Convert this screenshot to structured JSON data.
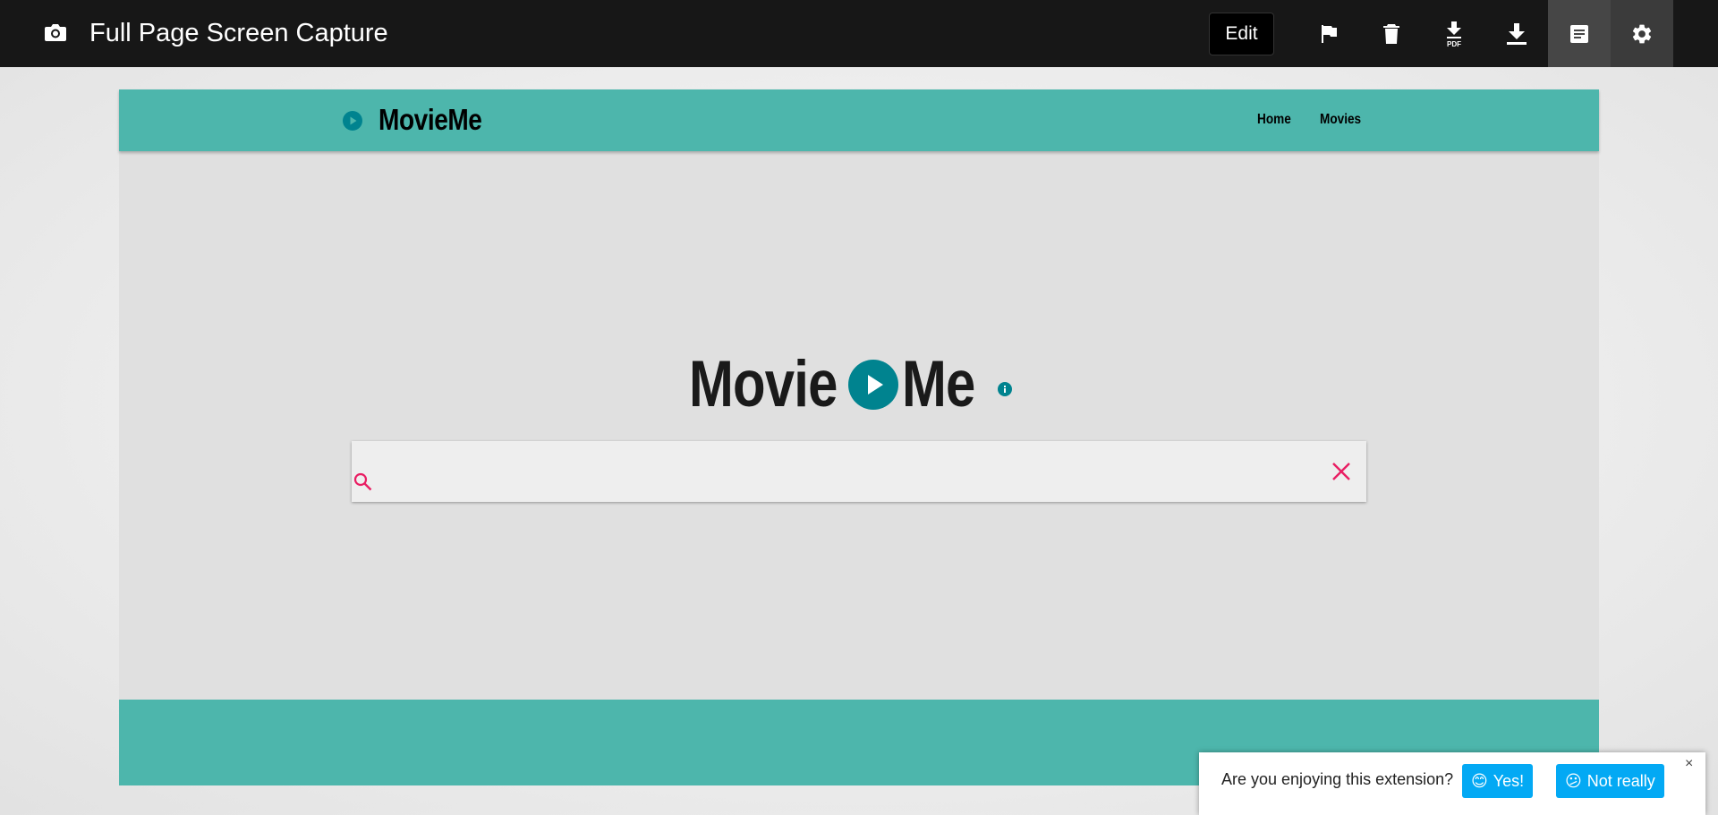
{
  "toolbar": {
    "title": "Full Page Screen Capture",
    "edit_label": "Edit",
    "icons": [
      "camera-icon",
      "flag-icon",
      "trash-icon",
      "download-pdf-icon",
      "download-icon",
      "notes-icon",
      "gear-icon"
    ],
    "pdf_badge": "PDF"
  },
  "site": {
    "brand": "MovieMe",
    "nav": {
      "home": "Home",
      "movies": "Movies"
    },
    "hero_left": "Movie",
    "hero_right": "Me",
    "search_placeholder": "",
    "search_value": ""
  },
  "feedback": {
    "question": "Are you enjoying this extension?",
    "yes_label": "Yes!",
    "yes_emoji": "😊",
    "no_label": "Not really",
    "no_emoji": "😕",
    "close": "×"
  },
  "colors": {
    "toolbar_bg": "#171717",
    "teal": "#4db6ac",
    "dark_teal": "#00838f",
    "accent_pink": "#e91e63",
    "button_blue": "#03a9f4"
  }
}
